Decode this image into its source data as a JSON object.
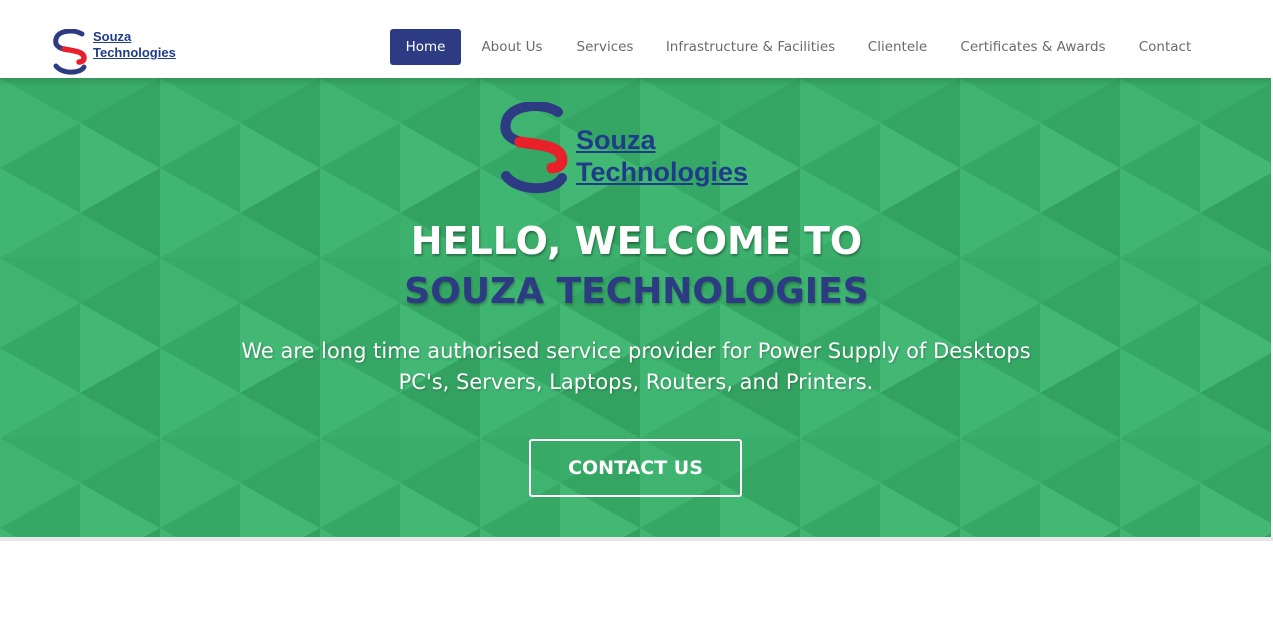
{
  "brand": {
    "name_line1": "Souza",
    "name_line2": "Technologies",
    "logo_icon": "souza-s-logo-icon",
    "colors": {
      "primary": "#2d3b82",
      "accent": "#e8202a",
      "hero_bg": "#3aad6a"
    }
  },
  "nav": {
    "items": [
      {
        "label": "Home",
        "active": true
      },
      {
        "label": "About Us",
        "active": false
      },
      {
        "label": "Services",
        "active": false
      },
      {
        "label": "Infrastructure & Facilities",
        "active": false
      },
      {
        "label": "Clientele",
        "active": false
      },
      {
        "label": "Certificates & Awards",
        "active": false
      },
      {
        "label": "Contact",
        "active": false
      }
    ]
  },
  "hero": {
    "title_line1": "HELLO, WELCOME TO",
    "title_line2": "SOUZA TECHNOLOGIES",
    "description": "We are long time authorised service provider for Power Supply of Desktops PC's, Servers, Laptops, Routers, and Printers.",
    "cta_label": "CONTACT US"
  }
}
